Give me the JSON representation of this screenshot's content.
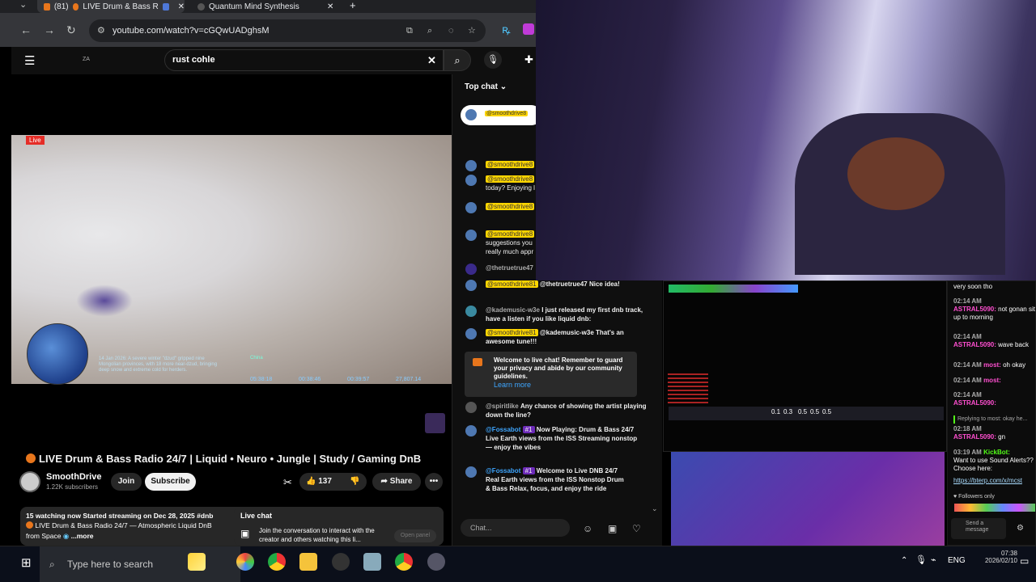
{
  "browser": {
    "tabs": [
      {
        "label": "(81)"
      },
      {
        "label": "LIVE Drum & Bass R"
      },
      {
        "label": "Quantum Mind Synthesis"
      }
    ],
    "url": "youtube.com/watch?v=cGQwUADghsM"
  },
  "youtube": {
    "search": "rust cohle",
    "header_small": "ZA"
  },
  "video": {
    "live_badge": "Live",
    "overlay_text": "14 Jan 2026: A severe winter \"dzud\" gripped nine Mongolian provinces, with 18 more near-dzud, bringing deep snow and extreme cold for herders.",
    "overlay_label": "China",
    "readouts": [
      "05:38:18",
      "00:38:46",
      "00:39:57",
      "27,807.14"
    ],
    "title": "LIVE Drum & Bass Radio 24/7 | Liquid • Neuro • Jungle | Study / Gaming DnB",
    "channel": "SmoothDrive",
    "subscribers": "1.22K subscribers",
    "join": "Join",
    "subscribe": "Subscribe",
    "likes": "137",
    "share": "Share",
    "desc_line1": "15 watching now  Started streaming on Dec 28, 2025  #dnb",
    "desc_line2": "LIVE Drum & Bass Radio 24/7 — Atmospheric Liquid DnB",
    "desc_line3": "from Space",
    "more": "...more",
    "livechat_title": "Live chat",
    "livechat_text": "Join the conversation to interact with the creator and others watching this li...",
    "open_panel": "Open panel"
  },
  "chat": {
    "header": "Top chat",
    "pinned": "@smoothdrive8",
    "messages": [
      {
        "tag": "@smoothdrive8",
        "text": ""
      },
      {
        "tag": "@smoothdrive8",
        "text": "today? Enjoying l"
      },
      {
        "tag": "@smoothdrive8",
        "text": ""
      },
      {
        "tag": "@smoothdrive8",
        "text": "suggestions you really much appr"
      },
      {
        "name": "@thetruetrue47",
        "text": ""
      },
      {
        "tag": "@smoothdrive81",
        "text": "@thetruetrue47 Nice idea!"
      },
      {
        "name": "@kademusic-w3e",
        "text": "I just released my first dnb track, have a listen if you like liquid dnb:"
      },
      {
        "tag": "@smoothdrive81",
        "text": "@kademusic-w3e That's an awesome tune!!!"
      }
    ],
    "welcome": "Welcome to live chat! Remember to guard your privacy and abide by our community guidelines.",
    "learn_more": "Learn more",
    "messages2": [
      {
        "name": "@spiritlike",
        "text": "Any chance of showing the artist playing down the line?"
      },
      {
        "name": "@Fossabot",
        "badge": "#1",
        "text": "Now Playing: Drum & Bass 24/7  Live Earth views from the ISS  Streaming nonstop — enjoy the vibes"
      },
      {
        "name": "@Fossabot",
        "badge": "#1",
        "text": "Welcome to Live DNB 24/7 Real Earth views from the ISS  Nonstop Drum & Bass  Relax, focus, and enjoy the ride"
      }
    ],
    "input_placeholder": "Chat..."
  },
  "kick": {
    "lines": [
      {
        "time": "",
        "user": "",
        "text": "very soon tho"
      },
      {
        "time": "02:14 AM",
        "user": "ASTRAL5090:",
        "text": "not gonan sit up to morning"
      },
      {
        "time": "02:14 AM",
        "user": "ASTRAL5090:",
        "text": "wave back"
      },
      {
        "time": "02:14 AM",
        "user": "most:",
        "text": "oh okay"
      },
      {
        "time": "02:14 AM",
        "user": "most:",
        "text": ""
      },
      {
        "time": "02:14 AM",
        "user": "ASTRAL5090:",
        "text": ""
      },
      {
        "time": "",
        "user": "",
        "text": "Replying to most: okay he..."
      },
      {
        "time": "02:18 AM",
        "user": "ASTRAL5090:",
        "text": "gn"
      },
      {
        "time": "03:19 AM",
        "user": "KickBot:",
        "text": "Want to use Sound Alerts?? Choose here:"
      },
      {
        "time": "",
        "user": "",
        "text": "https://bterp.com/x/mcst"
      }
    ],
    "followers_only": "Followers only",
    "send": "Send a message"
  },
  "game": {
    "hud": [
      "0.1",
      "0.3",
      "0.5",
      "0.5",
      "0.5"
    ]
  },
  "taskbar": {
    "search": "Type here to search",
    "lang": "ENG",
    "time": "07:38",
    "date": "2026/02/10"
  }
}
